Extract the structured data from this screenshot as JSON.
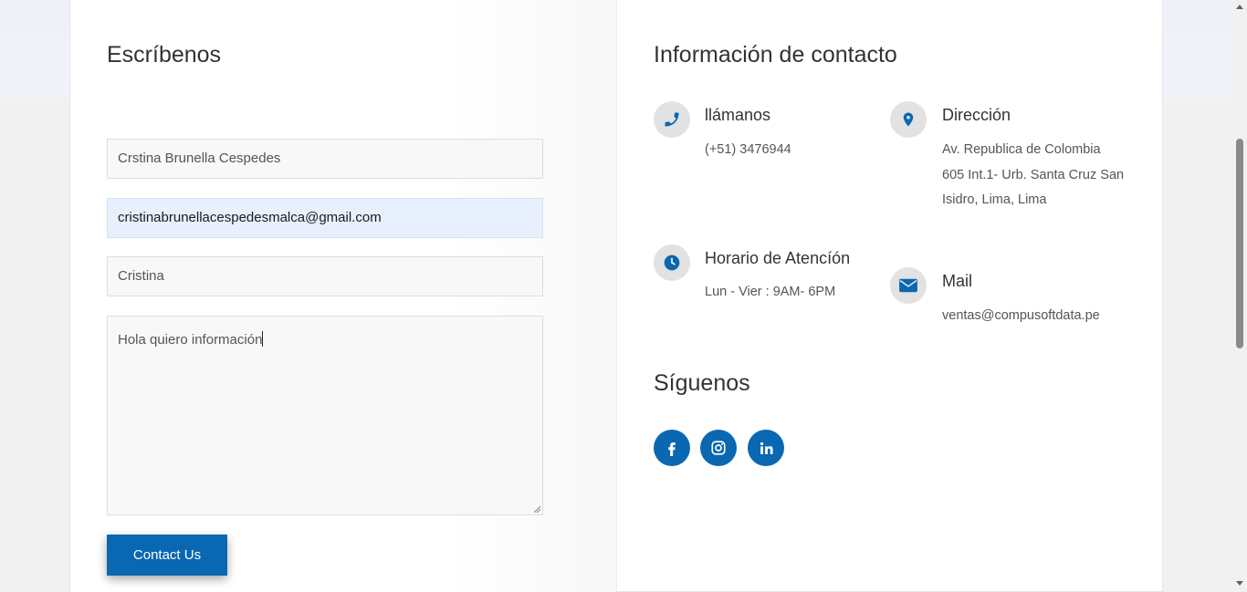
{
  "form": {
    "title": "Escríbenos",
    "name_value": "Crstina Brunella Cespedes",
    "email_value": "cristinabrunellacespedesmalca@gmail.com",
    "subject_value": "Cristina",
    "message_value": "Hola quiero información",
    "submit_label": "Contact Us"
  },
  "contact_info": {
    "title": "Información de contacto",
    "phone": {
      "icon": "phone-icon",
      "heading": "llámanos",
      "text": "(+51) 3476944"
    },
    "address": {
      "icon": "map-pin-icon",
      "heading": "Dirección",
      "lines": [
        "Av. Republica de Colombia",
        "605 Int.1- Urb. Santa Cruz San",
        "Isidro, Lima, Lima"
      ]
    },
    "hours": {
      "icon": "clock-icon",
      "heading": "Horario de Atencíón",
      "text": "Lun - Vier : 9AM- 6PM"
    },
    "mail": {
      "icon": "envelope-icon",
      "heading": "Mail",
      "text": "ventas@compusoftdata.pe"
    }
  },
  "follow": {
    "title": "Síguenos",
    "networks": [
      "facebook-icon",
      "instagram-icon",
      "linkedin-icon"
    ]
  },
  "colors": {
    "accent": "#0a67b2",
    "icon_bg": "#e2e2e2"
  }
}
